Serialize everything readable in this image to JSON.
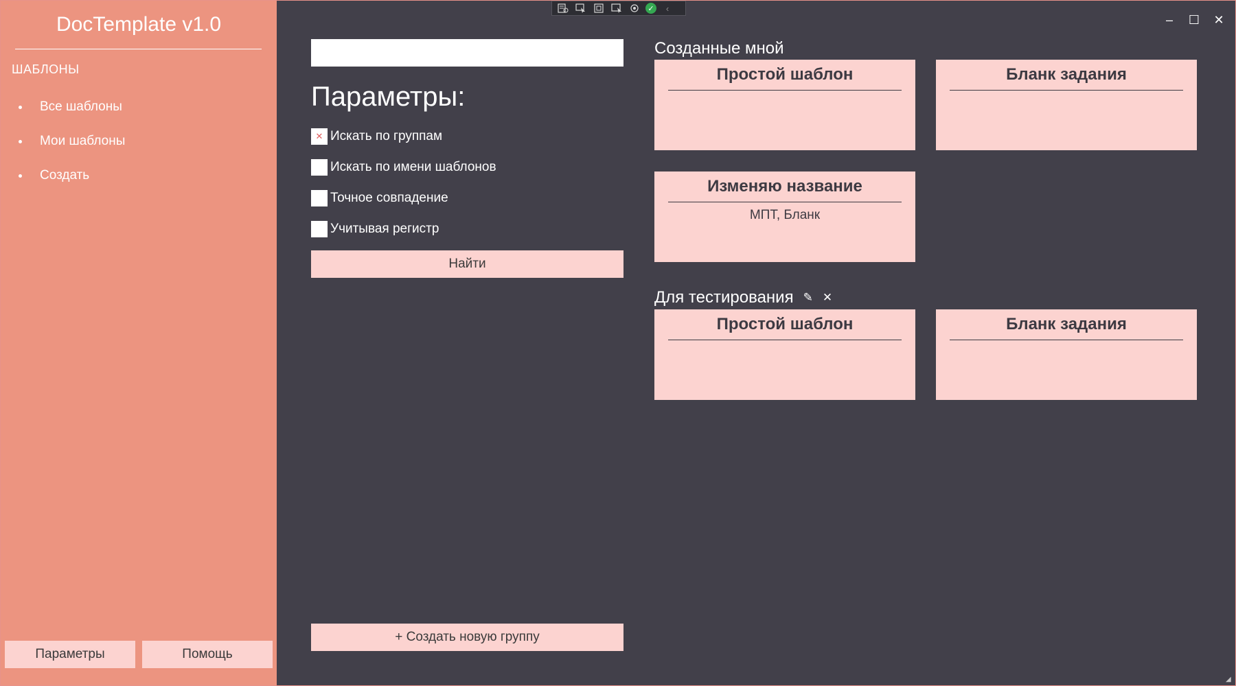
{
  "app": {
    "title": "DocTemplate v1.0"
  },
  "sidebar": {
    "section_label": "ШАБЛОНЫ",
    "items": [
      {
        "label": "Все шаблоны"
      },
      {
        "label": "Мои шаблоны"
      },
      {
        "label": "Создать"
      }
    ],
    "params_button": "Параметры",
    "help_button": "Помощь"
  },
  "window_controls": {
    "minimize": "–",
    "maximize": "☐",
    "close": "✕"
  },
  "debug_toolbar": {
    "icons": [
      "live-tree-icon",
      "select-element-icon",
      "display-layout-icon",
      "track-focus-icon",
      "hot-reload-icon",
      "success-check-icon",
      "collapse-chevron-icon"
    ]
  },
  "search": {
    "query": "",
    "placeholder": "",
    "params_title": "Параметры:",
    "options": [
      {
        "label": "Искать по группам",
        "checked": true
      },
      {
        "label": "Искать по имени шаблонов",
        "checked": false
      },
      {
        "label": "Точное совпадение",
        "checked": false
      },
      {
        "label": "Учитывая регистр",
        "checked": false
      }
    ],
    "find_button": "Найти",
    "new_group_button": "+ Создать новую группу"
  },
  "groups": [
    {
      "title": "Созданные мной",
      "editable": false,
      "cards": [
        {
          "title": "Простой шаблон",
          "tags": ""
        },
        {
          "title": "Бланк задания",
          "tags": ""
        },
        {
          "title": "Изменяю название",
          "tags": "МПТ, Бланк"
        }
      ]
    },
    {
      "title": "Для тестирования",
      "editable": true,
      "cards": [
        {
          "title": "Простой шаблон",
          "tags": ""
        },
        {
          "title": "Бланк задания",
          "tags": ""
        }
      ]
    }
  ],
  "colors": {
    "sidebar_bg": "#ec9480",
    "main_bg": "#42404a",
    "card_bg": "#fcd3d0",
    "card_text": "#3d3a42",
    "accent_check": "#e06060"
  }
}
